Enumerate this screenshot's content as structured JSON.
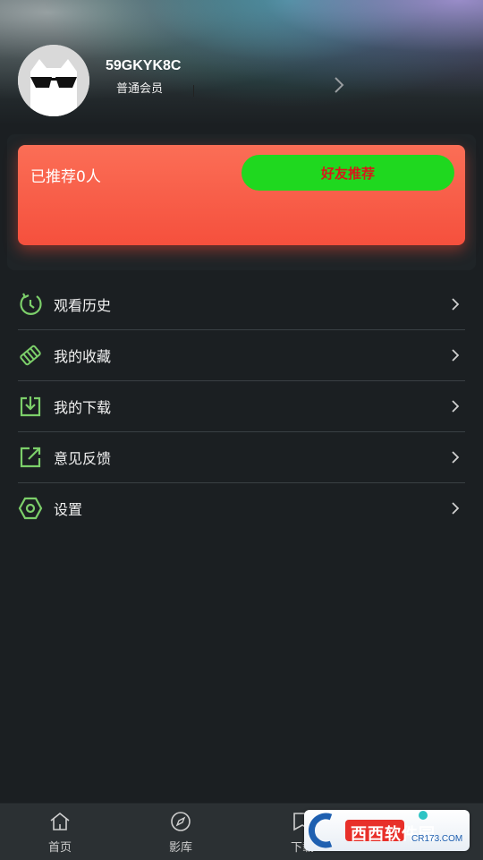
{
  "profile": {
    "username": "59GKYK8C",
    "member_level": "普通会员"
  },
  "referral": {
    "count_text": "已推荐0人",
    "invite_button": "好友推荐"
  },
  "menu": [
    {
      "label": "观看历史",
      "icon": "history-icon"
    },
    {
      "label": "我的收藏",
      "icon": "favorites-icon"
    },
    {
      "label": "我的下载",
      "icon": "download-icon"
    },
    {
      "label": "意见反馈",
      "icon": "feedback-icon"
    },
    {
      "label": "设置",
      "icon": "settings-icon"
    }
  ],
  "bottom_nav": [
    {
      "label": "首页",
      "icon": "home-icon"
    },
    {
      "label": "影库",
      "icon": "compass-icon"
    },
    {
      "label": "下载",
      "icon": "download-tab-icon"
    }
  ],
  "watermark": {
    "text": "西西软件园",
    "subtext": "CR173.COM"
  },
  "colors": {
    "background": "#1b1f22",
    "card_start": "#fb6e56",
    "card_end": "#f5503d",
    "invite_button": "#1fd81f",
    "invite_text": "#d61a1a",
    "icon_green": "#7ccf6a"
  }
}
